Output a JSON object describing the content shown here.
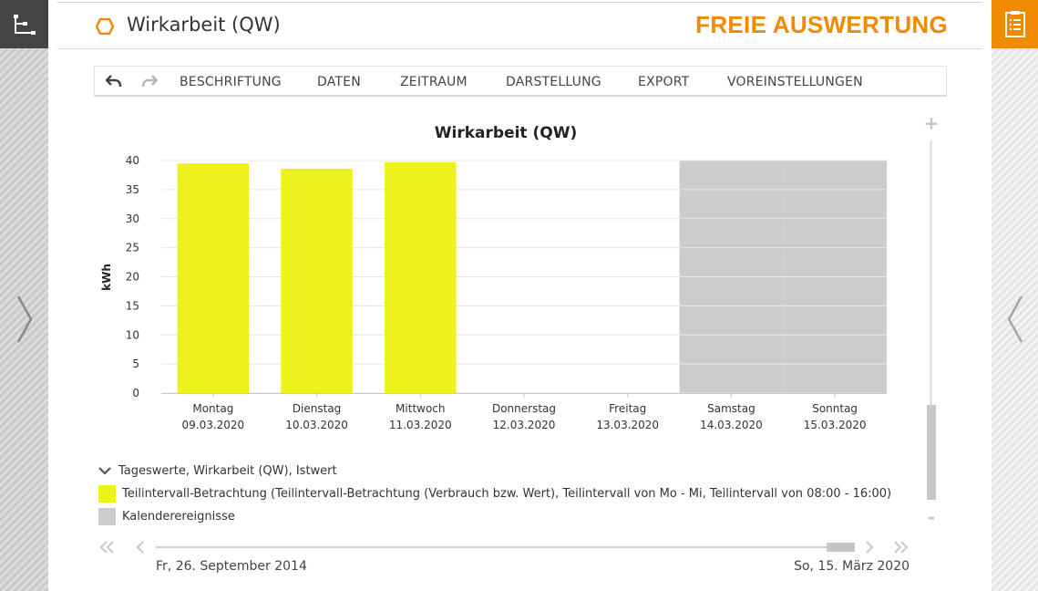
{
  "app": {
    "page_title": "Wirkarbeit (QW)",
    "brand_title": "FREIE AUSWERTUNG"
  },
  "icons": {
    "left_rail_top": "tree-structure-icon",
    "right_rail_top": "report-list-icon",
    "title_marker": "hexagon-icon",
    "undo": "undo-icon",
    "redo": "redo-icon",
    "left_rail_nav": "chevron-right-icon",
    "right_rail_nav": "chevron-left-icon",
    "legend_toggle": "chevron-down-icon",
    "first": "double-chevron-left-icon",
    "prev": "chevron-left-icon",
    "next": "chevron-right-icon",
    "last": "double-chevron-right-icon"
  },
  "toolbar": {
    "items": [
      {
        "label": "BESCHRIFTUNG"
      },
      {
        "label": "DATEN"
      },
      {
        "label": "ZEITRAUM"
      },
      {
        "label": "DARSTELLUNG"
      },
      {
        "label": "EXPORT"
      },
      {
        "label": "VOREINSTELLUNGEN"
      }
    ]
  },
  "chart_data": {
    "type": "bar",
    "title": "Wirkarbeit (QW)",
    "xlabel": "",
    "ylabel": "kWh",
    "ylim": [
      0,
      40
    ],
    "yticks": [
      0,
      5,
      10,
      15,
      20,
      25,
      30,
      35,
      40
    ],
    "grid": true,
    "categories": [
      {
        "day": "Montag",
        "date": "09.03.2020"
      },
      {
        "day": "Dienstag",
        "date": "10.03.2020"
      },
      {
        "day": "Mittwoch",
        "date": "11.03.2020"
      },
      {
        "day": "Donnerstag",
        "date": "12.03.2020"
      },
      {
        "day": "Freitag",
        "date": "13.03.2020"
      },
      {
        "day": "Samstag",
        "date": "14.03.2020"
      },
      {
        "day": "Sonntag",
        "date": "15.03.2020"
      }
    ],
    "series": [
      {
        "name": "Teilintervall-Betrachtung (Teilintervall-Betrachtung (Verbrauch bzw. Wert), Teilintervall von Mo - Mi, Teilintervall von 08:00 - 16:00)",
        "color": "#eef21c",
        "values": [
          39.5,
          38.6,
          39.7,
          null,
          null,
          null,
          null
        ]
      }
    ],
    "calendar_events": {
      "name": "Kalenderereignisse",
      "color": "#cccccc",
      "categories": [
        "Samstag",
        "Sonntag"
      ]
    },
    "colors": {
      "bar": "#eef21c",
      "event_band": "#cccccc",
      "grid": "#e6e6e6"
    }
  },
  "legend": {
    "group_label": "Tageswerte, Wirkarbeit (QW), Istwert",
    "entries": [
      {
        "label": "Teilintervall-Betrachtung (Teilintervall-Betrachtung (Verbrauch bzw. Wert), Teilintervall von Mo - Mi, Teilintervall von 08:00 - 16:00)",
        "color": "#eef21c"
      },
      {
        "label": "Kalenderereignisse",
        "color": "#cccccc"
      }
    ]
  },
  "zoom": {
    "plus": "+",
    "minus": "-",
    "level": 0.26
  },
  "timeline": {
    "start_date": "Fr, 26. September 2014",
    "end_date": "So, 15. März 2020",
    "window_end": 1.0
  },
  "colors": {
    "accent": "#f08a00",
    "rail_dark": "#444444"
  }
}
